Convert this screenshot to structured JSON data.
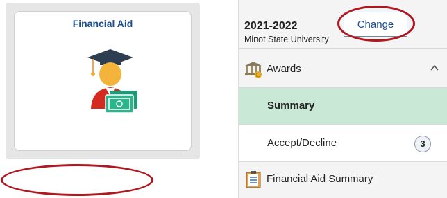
{
  "tile": {
    "title": "Financial Aid",
    "icon": "graduate-with-money-icon"
  },
  "aid_year": {
    "year": "2021-2022",
    "school": "Minot State University",
    "change_label": "Change"
  },
  "menu": {
    "awards": {
      "label": "Awards",
      "icon": "bank-icon",
      "expanded": true
    },
    "items": [
      {
        "label": "Summary",
        "selected": true
      },
      {
        "label": "Accept/Decline",
        "badge": "3"
      }
    ],
    "financial_aid_summary": {
      "label": "Financial Aid Summary",
      "icon": "clipboard-list-icon"
    }
  },
  "colors": {
    "tile_title": "#1b4e94",
    "selected_row": "#c9e8d6",
    "highlight_ring": "#b0171f"
  }
}
